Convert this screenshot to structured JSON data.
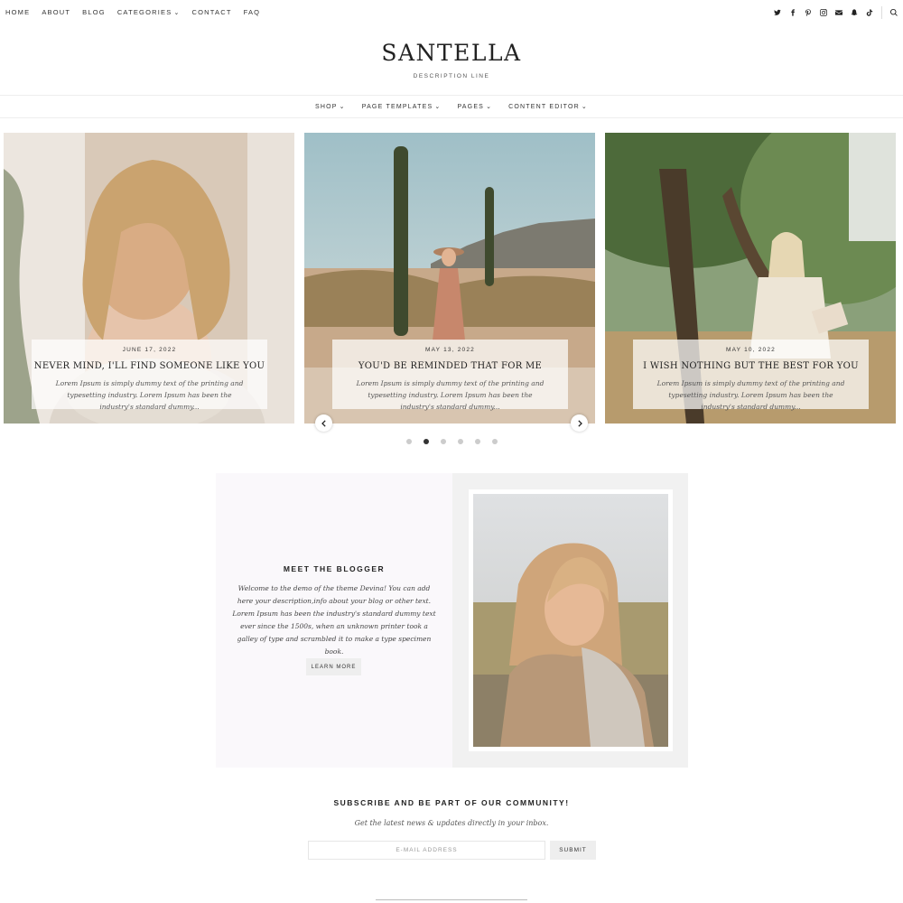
{
  "topnav": {
    "items": [
      {
        "label": "HOME"
      },
      {
        "label": "ABOUT"
      },
      {
        "label": "BLOG"
      },
      {
        "label": "CATEGORIES",
        "dropdown": true
      },
      {
        "label": "CONTACT"
      },
      {
        "label": "FAQ"
      }
    ],
    "social_icons": [
      "twitter-icon",
      "facebook-icon",
      "pinterest-icon",
      "instagram-icon",
      "email-icon",
      "snapchat-icon",
      "tiktok-icon",
      "search-icon"
    ]
  },
  "header": {
    "brand": "SANTELLA",
    "tagline": "DESCRIPTION LINE"
  },
  "mainnav": {
    "items": [
      {
        "label": "SHOP"
      },
      {
        "label": "PAGE TEMPLATES"
      },
      {
        "label": "PAGES"
      },
      {
        "label": "CONTENT EDITOR"
      }
    ]
  },
  "slider": {
    "slides": [
      {
        "date": "JUNE 17, 2022",
        "title": "NEVER MIND, I'LL FIND SOMEONE LIKE YOU",
        "excerpt": "Lorem Ipsum is simply dummy text of the printing and typesetting industry. Lorem Ipsum has been the industry's standard dummy..."
      },
      {
        "date": "MAY 13, 2022",
        "title": "YOU'D BE REMINDED THAT FOR ME",
        "excerpt": "Lorem Ipsum is simply dummy text of the printing and typesetting industry. Lorem Ipsum has been the industry's standard dummy..."
      },
      {
        "date": "MAY 10, 2022",
        "title": "I WISH NOTHING BUT THE BEST FOR YOU",
        "excerpt": "Lorem Ipsum is simply dummy text of the printing and typesetting industry. Lorem Ipsum has been the industry's standard dummy..."
      }
    ],
    "dots": 6,
    "active_dot": 2
  },
  "about": {
    "title": "MEET THE BLOGGER",
    "text": "Welcome to the demo of the theme Devina! You can add here your description,info about your blog or other text. Lorem Ipsum has been the industry's standard dummy text ever since the 1500s, when an unknown printer took a galley of type and scrambled it to make a type specimen book.",
    "button": "LEARN MORE"
  },
  "subscribe": {
    "title": "SUBSCRIBE AND BE PART OF OUR COMMUNITY!",
    "text": "Get the latest news & updates directly in your inbox.",
    "placeholder": "E-MAIL ADDRESS",
    "button": "SUBMIT"
  }
}
